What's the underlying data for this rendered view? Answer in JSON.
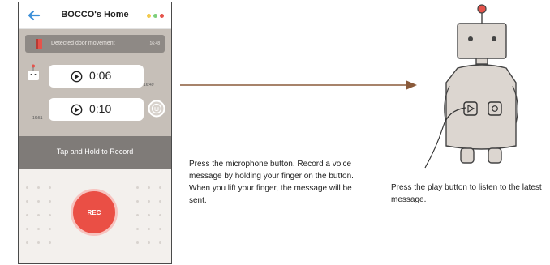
{
  "app": {
    "title": "BOCCO's Home",
    "back_icon": "back-arrow-icon",
    "status_dots": [
      "#f2c94c",
      "#7ccf7a",
      "#e5534b"
    ]
  },
  "chat": {
    "notice": {
      "text": "Detected door movement",
      "time": "16:48",
      "icon": "door-sensor-icon"
    },
    "messages": [
      {
        "from": "robot",
        "duration": "0:06",
        "time": "16:49",
        "icon": "play-icon"
      },
      {
        "from": "user",
        "duration": "0:10",
        "time": "16:51",
        "icon": "play-icon"
      }
    ]
  },
  "recorder": {
    "bar_label": "Tap and Hold to Record",
    "button_label": "REC",
    "accent": "#ea4f45"
  },
  "captions": {
    "left": "Press the microphone button. Record a voice message by holding your finger on the button. When you lift your finger, the message will be sent.",
    "right": "Press the play button to listen to the latest message."
  },
  "colors": {
    "chat_bg": "#c6bfb8",
    "record_bar": "#7f7b78",
    "arrow": "#8a5a3a",
    "robot_body": "#dcd6d0",
    "antenna_ball": "#e5534b"
  }
}
